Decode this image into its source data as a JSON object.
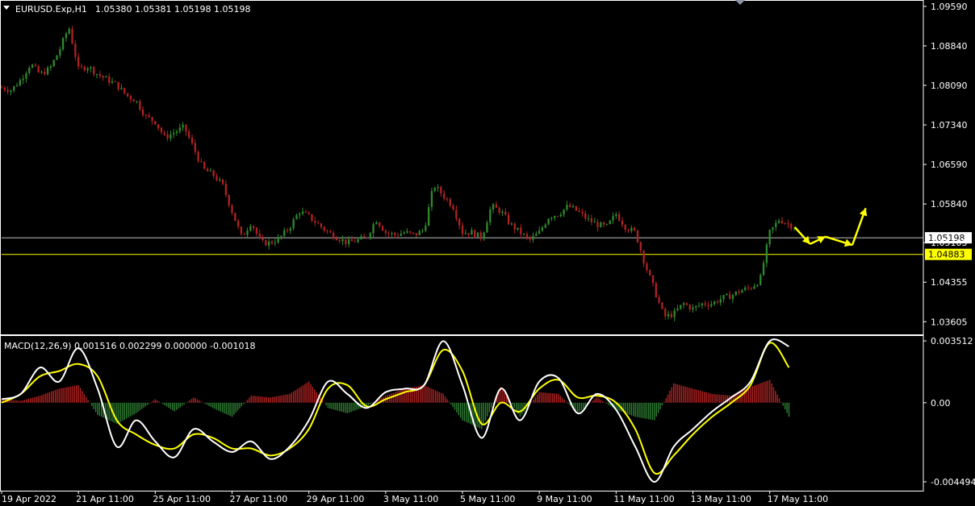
{
  "colors": {
    "background": "#000000",
    "frame": "#ffffff",
    "bull": "#2e8b2e",
    "bear": "#b22222",
    "macd_line": "#ffffff",
    "signal_line": "#ffff00",
    "hist_pos": "#b22222",
    "hist_neg": "#2e7d32",
    "level_gray": "#c0c0c0",
    "level_yellow": "#ffff00",
    "arrow": "#ffff00"
  },
  "main": {
    "header": {
      "symbol": "EURUSD.Exp,H1",
      "ohlc": "1.05380 1.05381 1.05198 1.05198"
    }
  },
  "macd": {
    "header": "MACD(12,26,9) 0.001516 0.002299 0.000000 -0.001018"
  },
  "chart_data": [
    {
      "type": "candlestick",
      "symbol": "EURUSD.Exp",
      "timeframe": "H1",
      "ylim": [
        1.0338,
        1.0968
      ],
      "y_ticks": [
        "1.09590",
        "1.08840",
        "1.08090",
        "1.07340",
        "1.06590",
        "1.05840",
        "1.05105",
        "1.04355",
        "1.03605"
      ],
      "x_ticks": [
        "19 Apr 2022",
        "21 Apr 11:00",
        "25 Apr 11:00",
        "27 Apr 11:00",
        "29 Apr 11:00",
        "3 May 11:00",
        "5 May 11:00",
        "9 May 11:00",
        "11 May 11:00",
        "13 May 11:00",
        "17 May 11:00"
      ],
      "price_path": [
        {
          "x": 0,
          "y": 1.0805
        },
        {
          "x": 0.5,
          "y": 1.08
        },
        {
          "x": 1,
          "y": 1.082
        },
        {
          "x": 1.5,
          "y": 1.085
        },
        {
          "x": 2,
          "y": 1.083
        },
        {
          "x": 2.5,
          "y": 1.084
        },
        {
          "x": 3,
          "y": 1.0875
        },
        {
          "x": 3.5,
          "y": 1.092
        },
        {
          "x": 4,
          "y": 1.084
        },
        {
          "x": 4.5,
          "y": 1.0845
        },
        {
          "x": 5,
          "y": 1.083
        },
        {
          "x": 5.5,
          "y": 1.082
        },
        {
          "x": 6,
          "y": 1.081
        },
        {
          "x": 6.5,
          "y": 1.079
        },
        {
          "x": 7,
          "y": 1.078
        },
        {
          "x": 7.5,
          "y": 1.075
        },
        {
          "x": 8,
          "y": 1.074
        },
        {
          "x": 8.5,
          "y": 1.071
        },
        {
          "x": 9,
          "y": 1.072
        },
        {
          "x": 9.5,
          "y": 1.073
        },
        {
          "x": 10,
          "y": 1.069
        },
        {
          "x": 10.5,
          "y": 1.065
        },
        {
          "x": 11,
          "y": 1.064
        },
        {
          "x": 11.5,
          "y": 1.062
        },
        {
          "x": 12,
          "y": 1.057
        },
        {
          "x": 12.5,
          "y": 1.052
        },
        {
          "x": 13,
          "y": 1.055
        },
        {
          "x": 13.5,
          "y": 1.051
        },
        {
          "x": 14,
          "y": 1.051
        },
        {
          "x": 14.5,
          "y": 1.052
        },
        {
          "x": 15,
          "y": 1.054
        },
        {
          "x": 15.5,
          "y": 1.057
        },
        {
          "x": 16,
          "y": 1.056
        },
        {
          "x": 16.5,
          "y": 1.0545
        },
        {
          "x": 17,
          "y": 1.053
        },
        {
          "x": 17.5,
          "y": 1.052
        },
        {
          "x": 18,
          "y": 1.051
        },
        {
          "x": 18.5,
          "y": 1.0515
        },
        {
          "x": 19,
          "y": 1.052
        },
        {
          "x": 19.5,
          "y": 1.0555
        },
        {
          "x": 20,
          "y": 1.053
        },
        {
          "x": 20.5,
          "y": 1.0525
        },
        {
          "x": 21,
          "y": 1.053
        },
        {
          "x": 21.5,
          "y": 1.0525
        },
        {
          "x": 22,
          "y": 1.0535
        },
        {
          "x": 22.5,
          "y": 1.062
        },
        {
          "x": 23,
          "y": 1.06
        },
        {
          "x": 23.5,
          "y": 1.058
        },
        {
          "x": 24,
          "y": 1.053
        },
        {
          "x": 24.5,
          "y": 1.053
        },
        {
          "x": 25,
          "y": 1.052
        },
        {
          "x": 25.5,
          "y": 1.058
        },
        {
          "x": 26,
          "y": 1.057
        },
        {
          "x": 26.5,
          "y": 1.0545
        },
        {
          "x": 27,
          "y": 1.053
        },
        {
          "x": 27.5,
          "y": 1.0515
        },
        {
          "x": 28,
          "y": 1.053
        },
        {
          "x": 28.5,
          "y": 1.056
        },
        {
          "x": 29,
          "y": 1.0565
        },
        {
          "x": 29.5,
          "y": 1.058
        },
        {
          "x": 30,
          "y": 1.057
        },
        {
          "x": 30.5,
          "y": 1.0555
        },
        {
          "x": 31,
          "y": 1.0545
        },
        {
          "x": 31.5,
          "y": 1.054
        },
        {
          "x": 32,
          "y": 1.0565
        },
        {
          "x": 32.5,
          "y": 1.054
        },
        {
          "x": 33,
          "y": 1.053
        },
        {
          "x": 33.5,
          "y": 1.047
        },
        {
          "x": 34,
          "y": 1.042
        },
        {
          "x": 34.5,
          "y": 1.037
        },
        {
          "x": 35,
          "y": 1.0375
        },
        {
          "x": 35.5,
          "y": 1.0395
        },
        {
          "x": 36,
          "y": 1.0385
        },
        {
          "x": 36.5,
          "y": 1.0395
        },
        {
          "x": 37,
          "y": 1.0395
        },
        {
          "x": 37.5,
          "y": 1.0405
        },
        {
          "x": 38,
          "y": 1.041
        },
        {
          "x": 38.5,
          "y": 1.042
        },
        {
          "x": 39,
          "y": 1.0425
        },
        {
          "x": 39.5,
          "y": 1.044
        },
        {
          "x": 40,
          "y": 1.053
        },
        {
          "x": 40.5,
          "y": 1.0555
        },
        {
          "x": 41,
          "y": 1.0545
        },
        {
          "x": 41.3,
          "y": 1.054
        }
      ],
      "levels": [
        {
          "label": "1.05198",
          "value": 1.05198,
          "color": "gray"
        },
        {
          "label": "1.04883",
          "value": 1.04883,
          "color": "yellow"
        }
      ],
      "forecast_arrows": [
        {
          "from": {
            "x": 41.3,
            "y": 1.054
          },
          "to": {
            "x": 42.1,
            "y": 1.0508
          }
        },
        {
          "from": {
            "x": 42.1,
            "y": 1.0508
          },
          "to": {
            "x": 42.9,
            "y": 1.0522
          }
        },
        {
          "from": {
            "x": 42.9,
            "y": 1.0522
          },
          "to": {
            "x": 44.3,
            "y": 1.0506
          }
        },
        {
          "from": {
            "x": 44.3,
            "y": 1.0506
          },
          "to": {
            "x": 45.0,
            "y": 1.0576
          }
        }
      ]
    },
    {
      "type": "line",
      "title": "MACD(12,26,9)",
      "ylim": [
        -0.005,
        0.0037
      ],
      "y_ticks": [
        "0.003512",
        "0.00",
        "-0.004494"
      ],
      "macd": [
        {
          "x": 0,
          "y": 0.0002
        },
        {
          "x": 1,
          "y": 0.0005
        },
        {
          "x": 2,
          "y": 0.002
        },
        {
          "x": 3,
          "y": 0.0012
        },
        {
          "x": 4,
          "y": 0.0031
        },
        {
          "x": 5,
          "y": 0.0008
        },
        {
          "x": 6,
          "y": -0.0025
        },
        {
          "x": 7,
          "y": -0.001
        },
        {
          "x": 8,
          "y": -0.0022
        },
        {
          "x": 9,
          "y": -0.0031
        },
        {
          "x": 10,
          "y": -0.0015
        },
        {
          "x": 11,
          "y": -0.0022
        },
        {
          "x": 12,
          "y": -0.0028
        },
        {
          "x": 13,
          "y": -0.0022
        },
        {
          "x": 14,
          "y": -0.0032
        },
        {
          "x": 15,
          "y": -0.0025
        },
        {
          "x": 16,
          "y": -0.001
        },
        {
          "x": 17,
          "y": 0.0012
        },
        {
          "x": 18,
          "y": 0.0005
        },
        {
          "x": 19,
          "y": -0.0003
        },
        {
          "x": 20,
          "y": 0.0006
        },
        {
          "x": 21,
          "y": 0.0008
        },
        {
          "x": 22,
          "y": 0.001
        },
        {
          "x": 23,
          "y": 0.0035
        },
        {
          "x": 24,
          "y": 0.001
        },
        {
          "x": 25,
          "y": -0.002
        },
        {
          "x": 26,
          "y": 0.0008
        },
        {
          "x": 27,
          "y": -0.001
        },
        {
          "x": 28,
          "y": 0.0012
        },
        {
          "x": 29,
          "y": 0.0014
        },
        {
          "x": 30,
          "y": -0.0006
        },
        {
          "x": 31,
          "y": 0.0005
        },
        {
          "x": 32,
          "y": -0.0004
        },
        {
          "x": 33,
          "y": -0.0025
        },
        {
          "x": 34,
          "y": -0.0045
        },
        {
          "x": 35,
          "y": -0.0025
        },
        {
          "x": 36,
          "y": -0.0015
        },
        {
          "x": 37,
          "y": -0.0005
        },
        {
          "x": 38,
          "y": 0.0003
        },
        {
          "x": 39,
          "y": 0.0012
        },
        {
          "x": 40,
          "y": 0.0035
        },
        {
          "x": 41,
          "y": 0.0032
        }
      ],
      "signal": [
        {
          "x": 0,
          "y": 0.0
        },
        {
          "x": 1,
          "y": 0.0005
        },
        {
          "x": 2,
          "y": 0.0015
        },
        {
          "x": 3,
          "y": 0.0018
        },
        {
          "x": 4,
          "y": 0.0022
        },
        {
          "x": 5,
          "y": 0.0015
        },
        {
          "x": 6,
          "y": -0.001
        },
        {
          "x": 7,
          "y": -0.0018
        },
        {
          "x": 8,
          "y": -0.0024
        },
        {
          "x": 9,
          "y": -0.0026
        },
        {
          "x": 10,
          "y": -0.0018
        },
        {
          "x": 11,
          "y": -0.002
        },
        {
          "x": 12,
          "y": -0.0026
        },
        {
          "x": 13,
          "y": -0.0026
        },
        {
          "x": 14,
          "y": -0.003
        },
        {
          "x": 15,
          "y": -0.0026
        },
        {
          "x": 16,
          "y": -0.0015
        },
        {
          "x": 17,
          "y": 0.0008
        },
        {
          "x": 18,
          "y": 0.001
        },
        {
          "x": 19,
          "y": -0.0002
        },
        {
          "x": 20,
          "y": 0.0002
        },
        {
          "x": 21,
          "y": 0.0006
        },
        {
          "x": 22,
          "y": 0.001
        },
        {
          "x": 23,
          "y": 0.003
        },
        {
          "x": 24,
          "y": 0.0018
        },
        {
          "x": 25,
          "y": -0.0012
        },
        {
          "x": 26,
          "y": 0.0
        },
        {
          "x": 27,
          "y": -0.0005
        },
        {
          "x": 28,
          "y": 0.0008
        },
        {
          "x": 29,
          "y": 0.0013
        },
        {
          "x": 30,
          "y": 0.0003
        },
        {
          "x": 31,
          "y": 0.0004
        },
        {
          "x": 32,
          "y": 0.0
        },
        {
          "x": 33,
          "y": -0.0015
        },
        {
          "x": 34,
          "y": -0.004
        },
        {
          "x": 35,
          "y": -0.003
        },
        {
          "x": 36,
          "y": -0.0018
        },
        {
          "x": 37,
          "y": -0.0008
        },
        {
          "x": 38,
          "y": 0.0
        },
        {
          "x": 39,
          "y": 0.001
        },
        {
          "x": 40,
          "y": 0.0034
        },
        {
          "x": 41,
          "y": 0.002
        }
      ],
      "histogram": [
        {
          "x": 0,
          "y": 0.0002
        },
        {
          "x": 1,
          "y": 0.0001
        },
        {
          "x": 2,
          "y": 0.0004
        },
        {
          "x": 3,
          "y": 0.0008
        },
        {
          "x": 4,
          "y": 0.001
        },
        {
          "x": 5,
          "y": -0.0007
        },
        {
          "x": 6,
          "y": -0.0012
        },
        {
          "x": 7,
          "y": -0.0006
        },
        {
          "x": 8,
          "y": 0.0002
        },
        {
          "x": 9,
          "y": -0.0005
        },
        {
          "x": 10,
          "y": 0.0003
        },
        {
          "x": 11,
          "y": -0.0003
        },
        {
          "x": 12,
          "y": -0.0008
        },
        {
          "x": 13,
          "y": 0.0004
        },
        {
          "x": 14,
          "y": 0.0003
        },
        {
          "x": 15,
          "y": 0.0005
        },
        {
          "x": 16,
          "y": 0.0012
        },
        {
          "x": 17,
          "y": -0.0003
        },
        {
          "x": 18,
          "y": -0.0006
        },
        {
          "x": 19,
          "y": -0.0002
        },
        {
          "x": 20,
          "y": 0.0004
        },
        {
          "x": 21,
          "y": 0.0008
        },
        {
          "x": 22,
          "y": 0.001
        },
        {
          "x": 23,
          "y": 0.0005
        },
        {
          "x": 24,
          "y": -0.001
        },
        {
          "x": 25,
          "y": -0.0015
        },
        {
          "x": 26,
          "y": 0.0009
        },
        {
          "x": 27,
          "y": -0.0008
        },
        {
          "x": 28,
          "y": 0.0006
        },
        {
          "x": 29,
          "y": 0.0005
        },
        {
          "x": 30,
          "y": -0.0006
        },
        {
          "x": 31,
          "y": 0.0003
        },
        {
          "x": 32,
          "y": -0.0004
        },
        {
          "x": 33,
          "y": -0.0008
        },
        {
          "x": 34,
          "y": -0.001
        },
        {
          "x": 35,
          "y": 0.0011
        },
        {
          "x": 36,
          "y": 0.0008
        },
        {
          "x": 37,
          "y": 0.0005
        },
        {
          "x": 38,
          "y": 0.0004
        },
        {
          "x": 39,
          "y": 0.0009
        },
        {
          "x": 40,
          "y": 0.0013
        },
        {
          "x": 41,
          "y": -0.0008
        }
      ]
    }
  ]
}
